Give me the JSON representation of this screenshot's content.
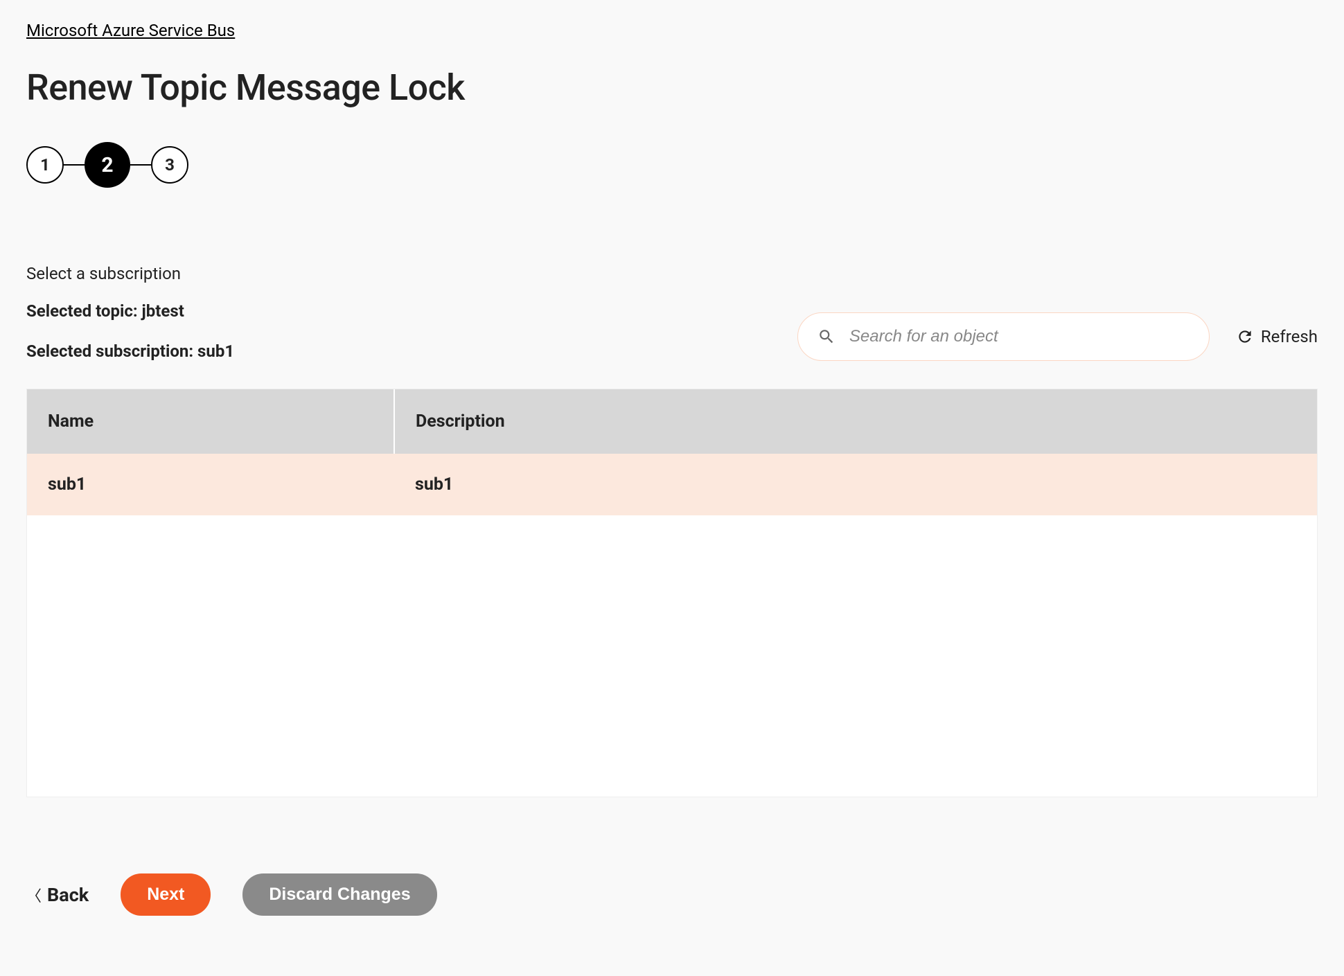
{
  "breadcrumb": "Microsoft Azure Service Bus",
  "page_title": "Renew Topic Message Lock",
  "stepper": {
    "steps": [
      "1",
      "2",
      "3"
    ],
    "active_index": 1
  },
  "section_label": "Select a subscription",
  "selected_topic_label": "Selected topic: jbtest",
  "selected_subscription_label": "Selected subscription: sub1",
  "search": {
    "placeholder": "Search for an object"
  },
  "refresh_label": "Refresh",
  "table": {
    "headers": {
      "name": "Name",
      "description": "Description"
    },
    "rows": [
      {
        "name": "sub1",
        "description": "sub1",
        "selected": true
      }
    ]
  },
  "footer": {
    "back": "Back",
    "next": "Next",
    "discard": "Discard Changes"
  }
}
